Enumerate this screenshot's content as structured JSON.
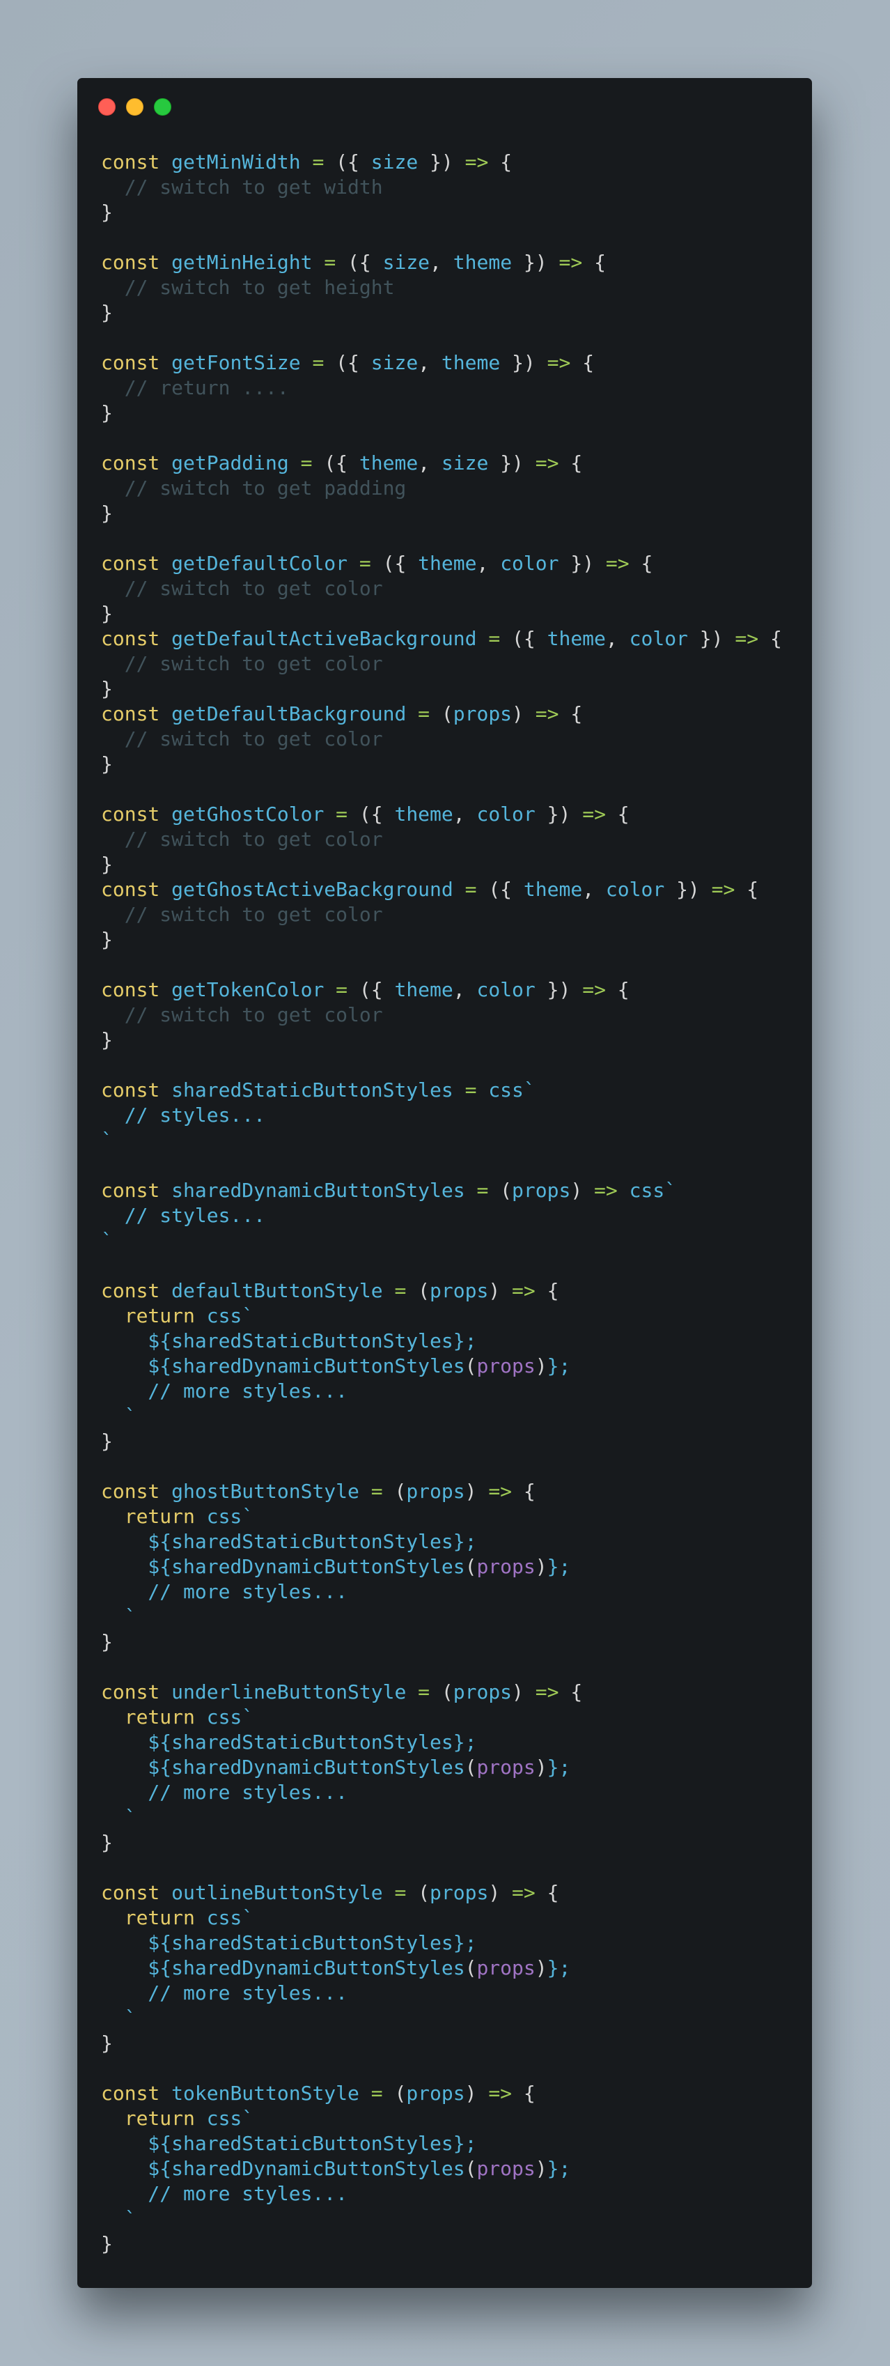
{
  "window": {
    "controls": [
      "close",
      "minimize",
      "maximize"
    ],
    "colors": {
      "background": "#171a1d",
      "keyword": "#e6cd69",
      "identifier": "#55b5db",
      "operator": "#9fca56",
      "punctuation": "#d6d6d6",
      "comment": "#41535b",
      "param": "#a074c4"
    }
  },
  "code": {
    "language": "javascript",
    "lines": [
      [
        [
          "kw",
          "const "
        ],
        [
          "id",
          "getMinWidth "
        ],
        [
          "op",
          "= "
        ],
        [
          "pn",
          "({ "
        ],
        [
          "id",
          "size "
        ],
        [
          "pn",
          "}) "
        ],
        [
          "op",
          "=> "
        ],
        [
          "pn",
          "{"
        ]
      ],
      [
        [
          "cm",
          "  // switch to get width"
        ]
      ],
      [
        [
          "pn",
          "}"
        ]
      ],
      [],
      [
        [
          "kw",
          "const "
        ],
        [
          "id",
          "getMinHeight "
        ],
        [
          "op",
          "= "
        ],
        [
          "pn",
          "({ "
        ],
        [
          "id",
          "size"
        ],
        [
          "pn",
          ", "
        ],
        [
          "id",
          "theme "
        ],
        [
          "pn",
          "}) "
        ],
        [
          "op",
          "=> "
        ],
        [
          "pn",
          "{"
        ]
      ],
      [
        [
          "cm",
          "  // switch to get height"
        ]
      ],
      [
        [
          "pn",
          "}"
        ]
      ],
      [],
      [
        [
          "kw",
          "const "
        ],
        [
          "id",
          "getFontSize "
        ],
        [
          "op",
          "= "
        ],
        [
          "pn",
          "({ "
        ],
        [
          "id",
          "size"
        ],
        [
          "pn",
          ", "
        ],
        [
          "id",
          "theme "
        ],
        [
          "pn",
          "}) "
        ],
        [
          "op",
          "=> "
        ],
        [
          "pn",
          "{"
        ]
      ],
      [
        [
          "cm",
          "  // return ...."
        ]
      ],
      [
        [
          "pn",
          "}"
        ]
      ],
      [],
      [
        [
          "kw",
          "const "
        ],
        [
          "id",
          "getPadding "
        ],
        [
          "op",
          "= "
        ],
        [
          "pn",
          "({ "
        ],
        [
          "id",
          "theme"
        ],
        [
          "pn",
          ", "
        ],
        [
          "id",
          "size "
        ],
        [
          "pn",
          "}) "
        ],
        [
          "op",
          "=> "
        ],
        [
          "pn",
          "{"
        ]
      ],
      [
        [
          "cm",
          "  // switch to get padding"
        ]
      ],
      [
        [
          "pn",
          "}"
        ]
      ],
      [],
      [
        [
          "kw",
          "const "
        ],
        [
          "id",
          "getDefaultColor "
        ],
        [
          "op",
          "= "
        ],
        [
          "pn",
          "({ "
        ],
        [
          "id",
          "theme"
        ],
        [
          "pn",
          ", "
        ],
        [
          "id",
          "color "
        ],
        [
          "pn",
          "}) "
        ],
        [
          "op",
          "=> "
        ],
        [
          "pn",
          "{"
        ]
      ],
      [
        [
          "cm",
          "  // switch to get color"
        ]
      ],
      [
        [
          "pn",
          "}"
        ]
      ],
      [
        [
          "kw",
          "const "
        ],
        [
          "id",
          "getDefaultActiveBackground "
        ],
        [
          "op",
          "= "
        ],
        [
          "pn",
          "({ "
        ],
        [
          "id",
          "theme"
        ],
        [
          "pn",
          ", "
        ],
        [
          "id",
          "color "
        ],
        [
          "pn",
          "}) "
        ],
        [
          "op",
          "=> "
        ],
        [
          "pn",
          "{"
        ]
      ],
      [
        [
          "cm",
          "  // switch to get color"
        ]
      ],
      [
        [
          "pn",
          "}"
        ]
      ],
      [
        [
          "kw",
          "const "
        ],
        [
          "id",
          "getDefaultBackground "
        ],
        [
          "op",
          "= "
        ],
        [
          "pn",
          "("
        ],
        [
          "id",
          "props"
        ],
        [
          "pn",
          ") "
        ],
        [
          "op",
          "=> "
        ],
        [
          "pn",
          "{"
        ]
      ],
      [
        [
          "cm",
          "  // switch to get color"
        ]
      ],
      [
        [
          "pn",
          "}"
        ]
      ],
      [],
      [
        [
          "kw",
          "const "
        ],
        [
          "id",
          "getGhostColor "
        ],
        [
          "op",
          "= "
        ],
        [
          "pn",
          "({ "
        ],
        [
          "id",
          "theme"
        ],
        [
          "pn",
          ", "
        ],
        [
          "id",
          "color "
        ],
        [
          "pn",
          "}) "
        ],
        [
          "op",
          "=> "
        ],
        [
          "pn",
          "{"
        ]
      ],
      [
        [
          "cm",
          "  // switch to get color"
        ]
      ],
      [
        [
          "pn",
          "}"
        ]
      ],
      [
        [
          "kw",
          "const "
        ],
        [
          "id",
          "getGhostActiveBackground "
        ],
        [
          "op",
          "= "
        ],
        [
          "pn",
          "({ "
        ],
        [
          "id",
          "theme"
        ],
        [
          "pn",
          ", "
        ],
        [
          "id",
          "color "
        ],
        [
          "pn",
          "}) "
        ],
        [
          "op",
          "=> "
        ],
        [
          "pn",
          "{"
        ]
      ],
      [
        [
          "cm",
          "  // switch to get color"
        ]
      ],
      [
        [
          "pn",
          "}"
        ]
      ],
      [],
      [
        [
          "kw",
          "const "
        ],
        [
          "id",
          "getTokenColor "
        ],
        [
          "op",
          "= "
        ],
        [
          "pn",
          "({ "
        ],
        [
          "id",
          "theme"
        ],
        [
          "pn",
          ", "
        ],
        [
          "id",
          "color "
        ],
        [
          "pn",
          "}) "
        ],
        [
          "op",
          "=> "
        ],
        [
          "pn",
          "{"
        ]
      ],
      [
        [
          "cm",
          "  // switch to get color"
        ]
      ],
      [
        [
          "pn",
          "}"
        ]
      ],
      [],
      [
        [
          "kw",
          "const "
        ],
        [
          "id",
          "sharedStaticButtonStyles "
        ],
        [
          "op",
          "= "
        ],
        [
          "tp",
          "css`"
        ]
      ],
      [
        [
          "tp",
          "  // styles..."
        ]
      ],
      [
        [
          "tp",
          "`"
        ]
      ],
      [],
      [
        [
          "kw",
          "const "
        ],
        [
          "id",
          "sharedDynamicButtonStyles "
        ],
        [
          "op",
          "= "
        ],
        [
          "pn",
          "("
        ],
        [
          "id",
          "props"
        ],
        [
          "pn",
          ") "
        ],
        [
          "op",
          "=> "
        ],
        [
          "tp",
          "css`"
        ]
      ],
      [
        [
          "tp",
          "  // styles..."
        ]
      ],
      [
        [
          "tp",
          "`"
        ]
      ],
      [],
      [
        [
          "kw",
          "const "
        ],
        [
          "id",
          "defaultButtonStyle "
        ],
        [
          "op",
          "= "
        ],
        [
          "pn",
          "("
        ],
        [
          "id",
          "props"
        ],
        [
          "pn",
          ") "
        ],
        [
          "op",
          "=> "
        ],
        [
          "pn",
          "{"
        ]
      ],
      [
        [
          "kw",
          "  return "
        ],
        [
          "tp",
          "css`"
        ]
      ],
      [
        [
          "tp",
          "    ${sharedStaticButtonStyles};"
        ]
      ],
      [
        [
          "tp",
          "    ${sharedDynamicButtonStyles"
        ],
        [
          "pn",
          "("
        ],
        [
          "pr",
          "props"
        ],
        [
          "pn",
          ")"
        ],
        [
          "tp",
          "};"
        ]
      ],
      [
        [
          "tp",
          "    // more styles..."
        ]
      ],
      [
        [
          "tp",
          "  `"
        ]
      ],
      [
        [
          "pn",
          "}"
        ]
      ],
      [],
      [
        [
          "kw",
          "const "
        ],
        [
          "id",
          "ghostButtonStyle "
        ],
        [
          "op",
          "= "
        ],
        [
          "pn",
          "("
        ],
        [
          "id",
          "props"
        ],
        [
          "pn",
          ") "
        ],
        [
          "op",
          "=> "
        ],
        [
          "pn",
          "{"
        ]
      ],
      [
        [
          "kw",
          "  return "
        ],
        [
          "tp",
          "css`"
        ]
      ],
      [
        [
          "tp",
          "    ${sharedStaticButtonStyles};"
        ]
      ],
      [
        [
          "tp",
          "    ${sharedDynamicButtonStyles"
        ],
        [
          "pn",
          "("
        ],
        [
          "pr",
          "props"
        ],
        [
          "pn",
          ")"
        ],
        [
          "tp",
          "};"
        ]
      ],
      [
        [
          "tp",
          "    // more styles..."
        ]
      ],
      [
        [
          "tp",
          "  `"
        ]
      ],
      [
        [
          "pn",
          "}"
        ]
      ],
      [],
      [
        [
          "kw",
          "const "
        ],
        [
          "id",
          "underlineButtonStyle "
        ],
        [
          "op",
          "= "
        ],
        [
          "pn",
          "("
        ],
        [
          "id",
          "props"
        ],
        [
          "pn",
          ") "
        ],
        [
          "op",
          "=> "
        ],
        [
          "pn",
          "{"
        ]
      ],
      [
        [
          "kw",
          "  return "
        ],
        [
          "tp",
          "css`"
        ]
      ],
      [
        [
          "tp",
          "    ${sharedStaticButtonStyles};"
        ]
      ],
      [
        [
          "tp",
          "    ${sharedDynamicButtonStyles"
        ],
        [
          "pn",
          "("
        ],
        [
          "pr",
          "props"
        ],
        [
          "pn",
          ")"
        ],
        [
          "tp",
          "};"
        ]
      ],
      [
        [
          "tp",
          "    // more styles..."
        ]
      ],
      [
        [
          "tp",
          "  `"
        ]
      ],
      [
        [
          "pn",
          "}"
        ]
      ],
      [],
      [
        [
          "kw",
          "const "
        ],
        [
          "id",
          "outlineButtonStyle "
        ],
        [
          "op",
          "= "
        ],
        [
          "pn",
          "("
        ],
        [
          "id",
          "props"
        ],
        [
          "pn",
          ") "
        ],
        [
          "op",
          "=> "
        ],
        [
          "pn",
          "{"
        ]
      ],
      [
        [
          "kw",
          "  return "
        ],
        [
          "tp",
          "css`"
        ]
      ],
      [
        [
          "tp",
          "    ${sharedStaticButtonStyles};"
        ]
      ],
      [
        [
          "tp",
          "    ${sharedDynamicButtonStyles"
        ],
        [
          "pn",
          "("
        ],
        [
          "pr",
          "props"
        ],
        [
          "pn",
          ")"
        ],
        [
          "tp",
          "};"
        ]
      ],
      [
        [
          "tp",
          "    // more styles..."
        ]
      ],
      [
        [
          "tp",
          "  `"
        ]
      ],
      [
        [
          "pn",
          "}"
        ]
      ],
      [],
      [
        [
          "kw",
          "const "
        ],
        [
          "id",
          "tokenButtonStyle "
        ],
        [
          "op",
          "= "
        ],
        [
          "pn",
          "("
        ],
        [
          "id",
          "props"
        ],
        [
          "pn",
          ") "
        ],
        [
          "op",
          "=> "
        ],
        [
          "pn",
          "{"
        ]
      ],
      [
        [
          "kw",
          "  return "
        ],
        [
          "tp",
          "css`"
        ]
      ],
      [
        [
          "tp",
          "    ${sharedStaticButtonStyles};"
        ]
      ],
      [
        [
          "tp",
          "    ${sharedDynamicButtonStyles"
        ],
        [
          "pn",
          "("
        ],
        [
          "pr",
          "props"
        ],
        [
          "pn",
          ")"
        ],
        [
          "tp",
          "};"
        ]
      ],
      [
        [
          "tp",
          "    // more styles..."
        ]
      ],
      [
        [
          "tp",
          "  `"
        ]
      ],
      [
        [
          "pn",
          "}"
        ]
      ]
    ]
  }
}
